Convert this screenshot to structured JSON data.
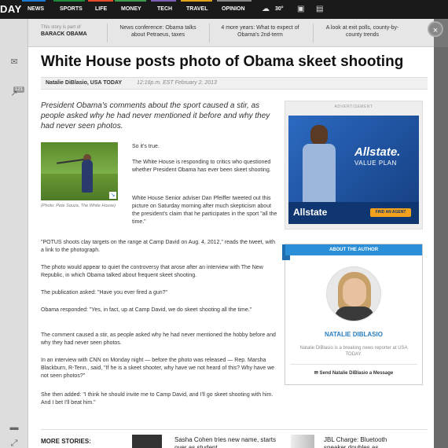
{
  "nav": {
    "logo": "DAY",
    "items": [
      "NEWS",
      "SPORTS",
      "LIFE",
      "MONEY",
      "TECH",
      "TRAVEL",
      "OPINION"
    ],
    "weather": "30°",
    "colors": [
      "#1f7bd1",
      "#1e8a3c",
      "#e54b2a",
      "#3d9c4f",
      "#7b5fb6",
      "#e0a21b",
      "#888888"
    ]
  },
  "strip": {
    "part_of": "This story is part of",
    "part_title": "BARACK OBAMA",
    "links": [
      "News conference: Obama talks about Petraeus, taxes",
      "4 more years: What to expect of Obama's 2nd-term",
      "A look at exit polls, county-by-county trends"
    ]
  },
  "close": "×",
  "article": {
    "headline": "White House posts photo of Obama skeet shooting",
    "byline": "Natalie DiBlasio, USA TODAY",
    "timestamp": "12:16p.m. EST February 2, 2013",
    "intro": "President Obama's comments about the sport caused a stir, as people asked why he had never mentioned it before and why they had never seen photos.",
    "photo_caption": "(Photo: Pete Souza, The White House)",
    "paragraphs": [
      "So it's true.",
      "The White House is responding to critics who questioned whether President Obama has ever been skeet shooting.",
      "White House Senior adviser Dan Pfeiffer tweeted out this picture on Saturday morning after much skepticism about the president's claim that he participates in the sport \"all the time.\"",
      "\"POTUS shoots clay targets on the range at Camp David on Aug. 4, 2012,\" reads the tweet, with a link to the photograph.",
      "The photo would appear to quiet the controversy that arose after an interview with The New Republic, in which Obama talked about frequent skeet shooting.",
      "The publication asked: \"Have you ever fired a gun?\"",
      "Obama responded: \"Yes, in fact, up at Camp David, we do skeet shooting all the time.\"",
      "The comment caused a stir, as people asked why he had never mentioned the hobby before and why they had never seen photos.",
      "In an interview with CNN on Monday night — before the photo was released — Rep. Marsha Blackburn, R-Tenn., said, \"If he is a skeet shooter, why have we not heard of this? Why have we not seen photos?\"",
      "She then added: \"I think he should invite me to Camp David, and I'll go skeet shooting with him. And I bet I'll beat him.\""
    ]
  },
  "ad": {
    "label": "ADVERTISEMENT",
    "brand": "Allstate.",
    "plan": "VALUE PLAN",
    "logo": "Allstate",
    "cta": "FIND AN AGENT"
  },
  "author": {
    "heading": "ABOUT THE AUTHOR",
    "name": "NATALIE DIBLASIO",
    "bio": "Natalie DiBlasio is a breaking news reporter at USA TODAY.",
    "message": "Send Natalie DiBlasio a Message"
  },
  "more": {
    "title": "MORE STORIES:",
    "story1": "Sasha Cohen tries new name, starts over as student",
    "story2": "JBL Charge: Bluetooth speaker doubles as"
  },
  "rail": {
    "count": "121"
  }
}
